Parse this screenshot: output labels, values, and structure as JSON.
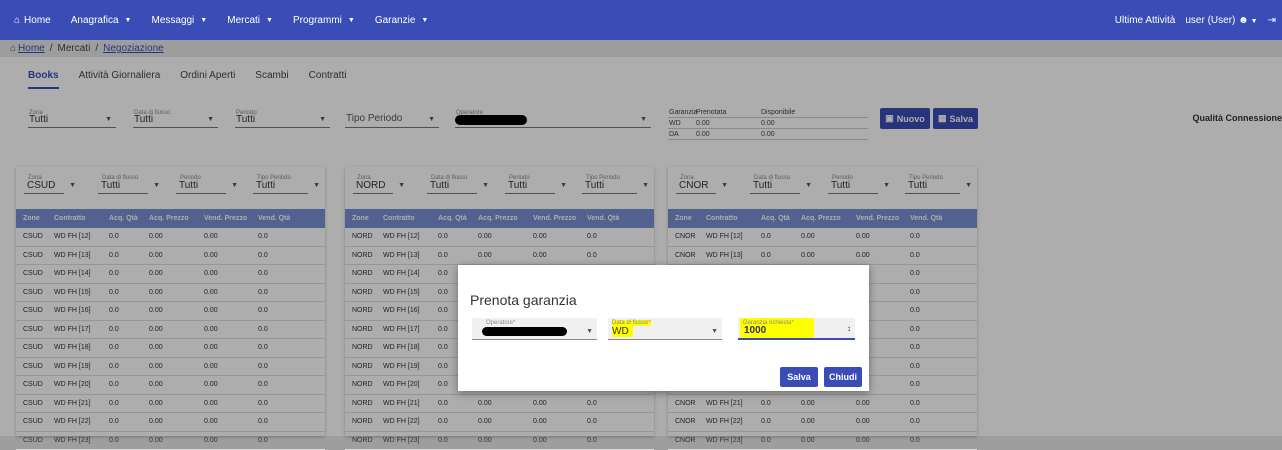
{
  "nav": {
    "home": "Home",
    "items": [
      "Anagrafica",
      "Messaggi",
      "Mercati",
      "Programmi",
      "Garanzie"
    ],
    "recent": "Ultime Attività",
    "user": "user (User)"
  },
  "breadcrumb": {
    "home": "Home",
    "mercati": "Mercati",
    "current": "Negoziazione"
  },
  "tabs": [
    "Books",
    "Attività Giornaliera",
    "Ordini Aperti",
    "Scambi",
    "Contratti"
  ],
  "filters": {
    "zona": {
      "label": "Zona",
      "value": "Tutti"
    },
    "data_flusso": {
      "label": "Data di flusso",
      "value": "Tutti"
    },
    "periodo": {
      "label": "Periodo",
      "value": "Tutti"
    },
    "tipo_periodo": {
      "placeholder": "Tipo Periodo"
    },
    "operatore": {
      "label": "Operatore"
    }
  },
  "garanzia": {
    "headers": [
      "Garanzia",
      "Prenotata",
      "Disponibile"
    ],
    "rows": [
      {
        "name": "WD",
        "prenotata": "0.00",
        "disponibile": "0.00"
      },
      {
        "name": "DA",
        "prenotata": "0.00",
        "disponibile": "0.00"
      }
    ]
  },
  "buttons": {
    "nuovo": "Nuovo",
    "salva": "Salva"
  },
  "quality": "Qualità Connessione",
  "book_labels": {
    "zona": "Zona",
    "data_flusso": "Data di flusso",
    "periodo": "Periodo",
    "tipo_periodo": "Tipo Periodo",
    "tutti": "Tutti"
  },
  "table_headers": [
    "Zone",
    "Contratto",
    "Acq. Qtà",
    "Acq. Prezzo",
    "Vend. Prezzo",
    "Vend. Qtà"
  ],
  "books": [
    {
      "zone": "CSUD",
      "rows": [
        [
          "CSUD",
          "WD FH [12]",
          "0.0",
          "0.00",
          "0.00",
          "0.0"
        ],
        [
          "CSUD",
          "WD FH [13]",
          "0.0",
          "0.00",
          "0.00",
          "0.0"
        ],
        [
          "CSUD",
          "WD FH [14]",
          "0.0",
          "0.00",
          "0.00",
          "0.0"
        ],
        [
          "CSUD",
          "WD FH [15]",
          "0.0",
          "0.00",
          "0.00",
          "0.0"
        ],
        [
          "CSUD",
          "WD FH [16]",
          "0.0",
          "0.00",
          "0.00",
          "0.0"
        ],
        [
          "CSUD",
          "WD FH [17]",
          "0.0",
          "0.00",
          "0.00",
          "0.0"
        ],
        [
          "CSUD",
          "WD FH [18]",
          "0.0",
          "0.00",
          "0.00",
          "0.0"
        ],
        [
          "CSUD",
          "WD FH [19]",
          "0.0",
          "0.00",
          "0.00",
          "0.0"
        ],
        [
          "CSUD",
          "WD FH [20]",
          "0.0",
          "0.00",
          "0.00",
          "0.0"
        ],
        [
          "CSUD",
          "WD FH [21]",
          "0.0",
          "0.00",
          "0.00",
          "0.0"
        ],
        [
          "CSUD",
          "WD FH [22]",
          "0.0",
          "0.00",
          "0.00",
          "0.0"
        ],
        [
          "CSUD",
          "WD FH [23]",
          "0.0",
          "0.00",
          "0.00",
          "0.0"
        ]
      ]
    },
    {
      "zone": "NORD",
      "rows": [
        [
          "NORD",
          "WD FH [12]",
          "0.0",
          "0.00",
          "0.00",
          "0.0"
        ],
        [
          "NORD",
          "WD FH [13]",
          "0.0",
          "0.00",
          "0.00",
          "0.0"
        ],
        [
          "NORD",
          "WD FH [14]",
          "0.0",
          "",
          "",
          ""
        ],
        [
          "NORD",
          "WD FH [15]",
          "0.0",
          "",
          "",
          ""
        ],
        [
          "NORD",
          "WD FH [16]",
          "0.0",
          "",
          "",
          ""
        ],
        [
          "NORD",
          "WD FH [17]",
          "0.0",
          "",
          "",
          ""
        ],
        [
          "NORD",
          "WD FH [18]",
          "0.0",
          "",
          "",
          ""
        ],
        [
          "NORD",
          "WD FH [19]",
          "0.0",
          "",
          "",
          ""
        ],
        [
          "NORD",
          "WD FH [20]",
          "0.0",
          "",
          "",
          ""
        ],
        [
          "NORD",
          "WD FH [21]",
          "0.0",
          "0.00",
          "0.00",
          "0.0"
        ],
        [
          "NORD",
          "WD FH [22]",
          "0.0",
          "0.00",
          "0.00",
          "0.0"
        ],
        [
          "NORD",
          "WD FH [23]",
          "0.0",
          "0.00",
          "0.00",
          "0.0"
        ]
      ]
    },
    {
      "zone": "CNOR",
      "rows": [
        [
          "CNOR",
          "WD FH [12]",
          "0.0",
          "0.00",
          "0.00",
          "0.0"
        ],
        [
          "CNOR",
          "WD FH [13]",
          "0.0",
          "0.00",
          "0.00",
          "0.0"
        ],
        [
          "",
          "",
          "",
          "",
          "0",
          "0.0"
        ],
        [
          "",
          "",
          "",
          "",
          "0",
          "0.0"
        ],
        [
          "",
          "",
          "",
          "",
          "0",
          "0.0"
        ],
        [
          "",
          "",
          "",
          "",
          "0",
          "0.0"
        ],
        [
          "",
          "",
          "",
          "",
          "0",
          "0.0"
        ],
        [
          "",
          "",
          "",
          "",
          "0",
          "0.0"
        ],
        [
          "",
          "",
          "",
          "",
          "0",
          "0.0"
        ],
        [
          "CNOR",
          "WD FH [21]",
          "0.0",
          "0.00",
          "0.00",
          "0.0"
        ],
        [
          "CNOR",
          "WD FH [22]",
          "0.0",
          "0.00",
          "0.00",
          "0.0"
        ],
        [
          "CNOR",
          "WD FH [23]",
          "0.0",
          "0.00",
          "0.00",
          "0.0"
        ]
      ]
    }
  ],
  "modal": {
    "title": "Prenota garanzia",
    "operatore_label": "Operatore*",
    "data_label": "Data di flusso*",
    "data_value": "WD",
    "garanzia_label": "Garanzia richiesta*",
    "garanzia_value": "1000",
    "salva": "Salva",
    "chiudi": "Chiudi"
  },
  "colors": {
    "primary": "#3a4db6",
    "table_header": "#7b8fd4",
    "highlight": "#ffff00"
  }
}
